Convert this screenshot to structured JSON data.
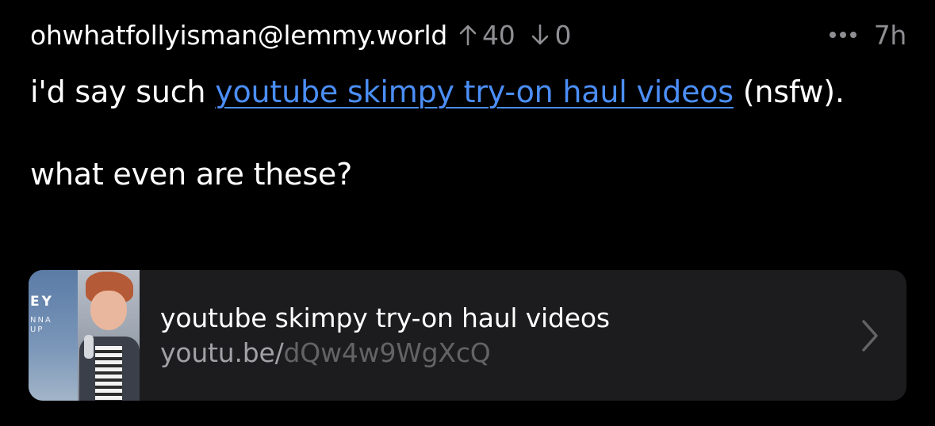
{
  "comment": {
    "author": "ohwhatfollyisman@lemmy.world",
    "upvotes": "40",
    "downvotes": "0",
    "time": "7h",
    "body": {
      "p1_prefix": "i'd say such ",
      "p1_link": "youtube skimpy try-on haul videos",
      "p1_suffix": " (nsfw).",
      "p2": "what even are these?"
    },
    "embed": {
      "title": "youtube skimpy try-on haul videos",
      "url_domain": "youtu.be/",
      "url_path": "dQw4w9WgXcQ",
      "thumbnail_text_large": "EY",
      "thumbnail_text_small_1": "NNA",
      "thumbnail_text_small_2": "UP"
    }
  },
  "colors": {
    "background": "#000000",
    "text": "#ffffff",
    "muted": "#8e8e93",
    "link": "#4b8ef7",
    "embed_bg": "#1c1c1e"
  },
  "icons": {
    "upvote": "arrow-up-icon",
    "downvote": "arrow-down-icon",
    "more": "ellipsis-icon",
    "chevron": "chevron-right-icon"
  }
}
